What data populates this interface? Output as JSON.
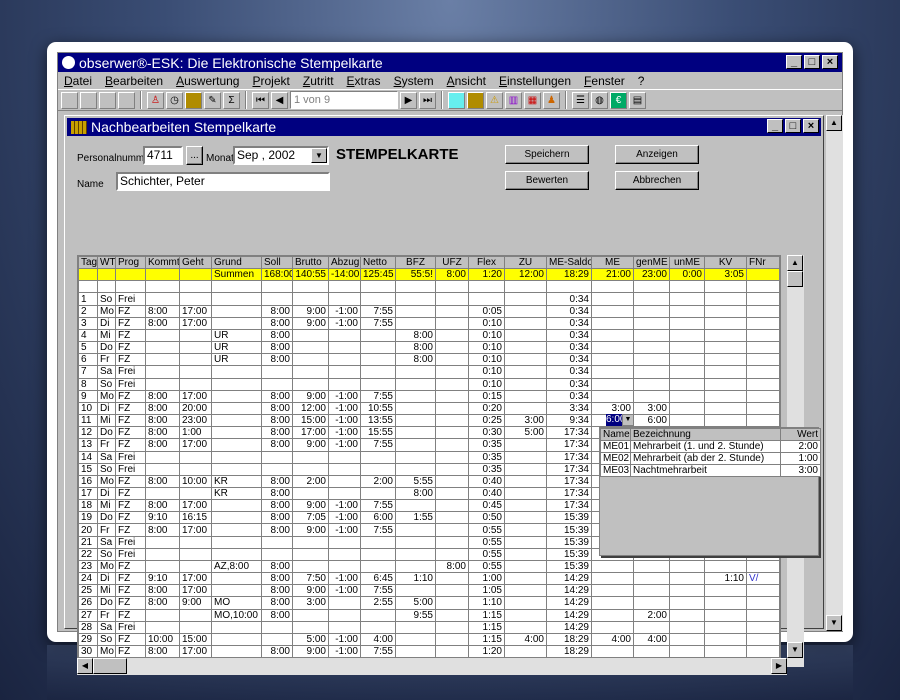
{
  "app": {
    "title": "obserwer®-ESK: Die Elektronische Stempelkarte"
  },
  "menu": [
    "Datei",
    "Bearbeiten",
    "Auswertung",
    "Projekt",
    "Zutritt",
    "Extras",
    "System",
    "Ansicht",
    "Einstellungen",
    "Fenster",
    "?"
  ],
  "toolbar": {
    "pager": "1   von  9"
  },
  "child": {
    "title": "Nachbearbeiten Stempelkarte",
    "personalnummer_label": "Personalnummer",
    "personalnummer": "4711",
    "browse": "...",
    "monat_label": "Monat",
    "monat": "Sep , 2002",
    "heading": "STEMPELKARTE",
    "name_label": "Name",
    "name": "Schichter, Peter",
    "buttons": {
      "speichern": "Speichern",
      "anzeigen": "Anzeigen",
      "bewerten": "Bewerten",
      "abbrechen": "Abbrechen"
    }
  },
  "table": {
    "columns": [
      "Tag",
      "WT",
      "Prog",
      "Kommt",
      "Geht",
      "Grund",
      "Soll",
      "Brutto",
      "Abzug",
      "Netto",
      "BFZ",
      "UFZ",
      "Flex",
      "ZU",
      "ME-Saldo",
      "ME",
      "genME",
      "unME",
      "KV",
      "FNr"
    ],
    "summen": [
      "",
      "",
      "",
      "",
      "",
      "Summen",
      "168:00",
      "140:55",
      "-14:00",
      "125:45",
      "55:5!",
      "8:00",
      "1:20",
      "12:00",
      "18:29",
      "21:00",
      "23:00",
      "0:00",
      "3:05",
      ""
    ],
    "rows": [
      [
        "1",
        "So",
        "Frei",
        "",
        "",
        "",
        "",
        "",
        "",
        "",
        "",
        "",
        "",
        "",
        "0:34",
        "",
        "",
        "",
        "",
        ""
      ],
      [
        "2",
        "Mo",
        "FZ",
        "8:00",
        "17:00",
        "",
        "8:00",
        "9:00",
        "-1:00",
        "7:55",
        "",
        "",
        "0:05",
        "",
        "0:34",
        "",
        "",
        "",
        "",
        ""
      ],
      [
        "3",
        "Di",
        "FZ",
        "8:00",
        "17:00",
        "",
        "8:00",
        "9:00",
        "-1:00",
        "7:55",
        "",
        "",
        "0:10",
        "",
        "0:34",
        "",
        "",
        "",
        "",
        ""
      ],
      [
        "4",
        "Mi",
        "FZ",
        "",
        "",
        "UR",
        "8:00",
        "",
        "",
        "",
        "8:00",
        "",
        "0:10",
        "",
        "0:34",
        "",
        "",
        "",
        "",
        ""
      ],
      [
        "5",
        "Do",
        "FZ",
        "",
        "",
        "UR",
        "8:00",
        "",
        "",
        "",
        "8:00",
        "",
        "0:10",
        "",
        "0:34",
        "",
        "",
        "",
        "",
        ""
      ],
      [
        "6",
        "Fr",
        "FZ",
        "",
        "",
        "UR",
        "8:00",
        "",
        "",
        "",
        "8:00",
        "",
        "0:10",
        "",
        "0:34",
        "",
        "",
        "",
        "",
        ""
      ],
      [
        "7",
        "Sa",
        "Frei",
        "",
        "",
        "",
        "",
        "",
        "",
        "",
        "",
        "",
        "0:10",
        "",
        "0:34",
        "",
        "",
        "",
        "",
        ""
      ],
      [
        "8",
        "So",
        "Frei",
        "",
        "",
        "",
        "",
        "",
        "",
        "",
        "",
        "",
        "0:10",
        "",
        "0:34",
        "",
        "",
        "",
        "",
        ""
      ],
      [
        "9",
        "Mo",
        "FZ",
        "8:00",
        "17:00",
        "",
        "8:00",
        "9:00",
        "-1:00",
        "7:55",
        "",
        "",
        "0:15",
        "",
        "0:34",
        "",
        "",
        "",
        "",
        ""
      ],
      [
        "10",
        "Di",
        "FZ",
        "8:00",
        "20:00",
        "",
        "8:00",
        "12:00",
        "-1:00",
        "10:55",
        "",
        "",
        "0:20",
        "",
        "3:34",
        "3:00",
        "3:00",
        "",
        "",
        ""
      ],
      [
        "11",
        "Mi",
        "FZ",
        "8:00",
        "23:00",
        "",
        "8:00",
        "15:00",
        "-1:00",
        "13:55",
        "",
        "",
        "0:25",
        "3:00",
        "9:34",
        "6:00",
        "6:00",
        "",
        "",
        ""
      ],
      [
        "12",
        "Do",
        "FZ",
        "8:00",
        "1:00",
        "",
        "8:00",
        "17:00",
        "-1:00",
        "15:55",
        "",
        "",
        "0:30",
        "5:00",
        "17:34",
        "",
        "",
        "",
        "",
        ""
      ],
      [
        "13",
        "Fr",
        "FZ",
        "8:00",
        "17:00",
        "",
        "8:00",
        "9:00",
        "-1:00",
        "7:55",
        "",
        "",
        "0:35",
        "",
        "17:34",
        "",
        "",
        "",
        "",
        ""
      ],
      [
        "14",
        "Sa",
        "Frei",
        "",
        "",
        "",
        "",
        "",
        "",
        "",
        "",
        "",
        "0:35",
        "",
        "17:34",
        "",
        "",
        "",
        "",
        ""
      ],
      [
        "15",
        "So",
        "Frei",
        "",
        "",
        "",
        "",
        "",
        "",
        "",
        "",
        "",
        "0:35",
        "",
        "17:34",
        "",
        "",
        "",
        "",
        ""
      ],
      [
        "16",
        "Mo",
        "FZ",
        "8:00",
        "10:00",
        "KR",
        "8:00",
        "2:00",
        "",
        "2:00",
        "5:55",
        "",
        "0:40",
        "",
        "17:34",
        "",
        "",
        "",
        "",
        ""
      ],
      [
        "17",
        "Di",
        "FZ",
        "",
        "",
        "KR",
        "8:00",
        "",
        "",
        "",
        "8:00",
        "",
        "0:40",
        "",
        "17:34",
        "",
        "",
        "",
        "",
        ""
      ],
      [
        "18",
        "Mi",
        "FZ",
        "8:00",
        "17:00",
        "",
        "8:00",
        "9:00",
        "-1:00",
        "7:55",
        "",
        "",
        "0:45",
        "",
        "17:34",
        "",
        "",
        "",
        "",
        ""
      ],
      [
        "19",
        "Do",
        "FZ",
        "9:10",
        "16:15",
        "",
        "8:00",
        "7:05",
        "-1:00",
        "6:00",
        "1:55",
        "",
        "0:50",
        "",
        "15:39",
        "",
        "",
        "",
        "",
        ""
      ],
      [
        "20",
        "Fr",
        "FZ",
        "8:00",
        "17:00",
        "",
        "8:00",
        "9:00",
        "-1:00",
        "7:55",
        "",
        "",
        "0:55",
        "",
        "15:39",
        "",
        "",
        "",
        "",
        ""
      ],
      [
        "21",
        "Sa",
        "Frei",
        "",
        "",
        "",
        "",
        "",
        "",
        "",
        "",
        "",
        "0:55",
        "",
        "15:39",
        "",
        "",
        "",
        "",
        ""
      ],
      [
        "22",
        "So",
        "Frei",
        "",
        "",
        "",
        "",
        "",
        "",
        "",
        "",
        "",
        "0:55",
        "",
        "15:39",
        "",
        "",
        "",
        "",
        ""
      ],
      [
        "23",
        "Mo",
        "FZ",
        "",
        "",
        "AZ,8:00",
        "8:00",
        "",
        "",
        "",
        "",
        "8:00",
        "0:55",
        "",
        "15:39",
        "",
        "",
        "",
        "",
        ""
      ],
      [
        "24",
        "Di",
        "FZ",
        "9:10",
        "17:00",
        "",
        "8:00",
        "7:50",
        "-1:00",
        "6:45",
        "1:10",
        "",
        "1:00",
        "",
        "14:29",
        "",
        "",
        "",
        "1:10",
        "V/"
      ],
      [
        "25",
        "Mi",
        "FZ",
        "8:00",
        "17:00",
        "",
        "8:00",
        "9:00",
        "-1:00",
        "7:55",
        "",
        "",
        "1:05",
        "",
        "14:29",
        "",
        "",
        "",
        "",
        ""
      ],
      [
        "26",
        "Do",
        "FZ",
        "8:00",
        "9:00",
        "MO",
        "8:00",
        "3:00",
        "",
        "2:55",
        "5:00",
        "",
        "1:10",
        "",
        "14:29",
        "",
        "",
        "",
        "",
        ""
      ],
      [
        "27",
        "Fr",
        "FZ",
        "",
        "",
        "MO,10:00",
        "8:00",
        "",
        "",
        "",
        "9:55",
        "",
        "1:15",
        "",
        "14:29",
        "",
        "2:00",
        "",
        "",
        ""
      ],
      [
        "28",
        "Sa",
        "Frei",
        "",
        "",
        "",
        "",
        "",
        "",
        "",
        "",
        "",
        "1:15",
        "",
        "14:29",
        "",
        "",
        "",
        "",
        ""
      ],
      [
        "29",
        "So",
        "FZ",
        "10:00",
        "15:00",
        "",
        "",
        "5:00",
        "-1:00",
        "4:00",
        "",
        "",
        "1:15",
        "4:00",
        "18:29",
        "4:00",
        "4:00",
        "",
        "",
        ""
      ],
      [
        "30",
        "Mo",
        "FZ",
        "8:00",
        "17:00",
        "",
        "8:00",
        "9:00",
        "-1:00",
        "7:55",
        "",
        "",
        "1:20",
        "",
        "18:29",
        "",
        "",
        "",
        "",
        ""
      ]
    ]
  },
  "editor": {
    "value": "6:00"
  },
  "popup": {
    "columns": [
      "Name",
      "Bezeichnung",
      "Wert"
    ],
    "rows": [
      [
        "ME01",
        "Mehrarbeit (1. und 2. Stunde)",
        "2:00"
      ],
      [
        "ME02",
        "Mehrarbeit (ab der 2. Stunde)",
        "1:00"
      ],
      [
        "ME03",
        "Nachtmehrarbeit",
        "3:00"
      ]
    ]
  }
}
